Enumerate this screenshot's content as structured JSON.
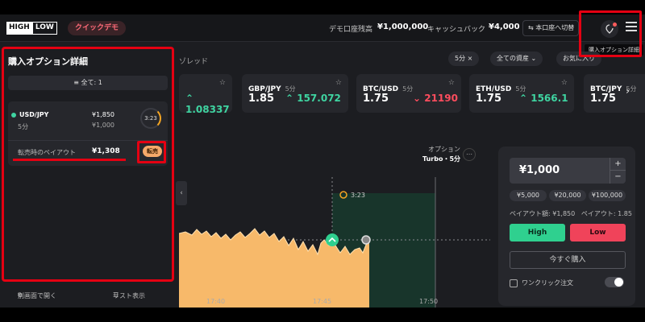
{
  "header": {
    "logo_high": "HIGH",
    "logo_low": "LOW",
    "demo_badge": "クイックデモ",
    "balance_label": "デモ口座残高",
    "balance_value": "¥1,000,000",
    "cashback_label": "キャッシュバック",
    "cashback_value": "¥4,000",
    "switch_account": "⇆ 本口座へ切替",
    "tooltip": "購入オプション詳細"
  },
  "filters": {
    "spread_label": "ゾレッド",
    "time_chip": "5分 ×",
    "asset_chip": "全ての資産 ⌄",
    "fav_chip": "お気に入り"
  },
  "assets": [
    {
      "name": "",
      "time": "",
      "payout": "",
      "price": "1.08337",
      "trend": "up"
    },
    {
      "name": "GBP/JPY",
      "time": "5分",
      "payout": "1.85",
      "price": "157.072",
      "trend": "up"
    },
    {
      "name": "BTC/USD",
      "time": "5分",
      "payout": "1.75",
      "price": "21190",
      "trend": "down"
    },
    {
      "name": "ETH/USD",
      "time": "5分",
      "payout": "1.75",
      "price": "1566.1",
      "trend": "up"
    },
    {
      "name": "BTC/JPY",
      "time": "5分",
      "payout": "1.75",
      "price": "",
      "trend": "up"
    }
  ],
  "left_panel": {
    "title": "購入オプション詳細",
    "filter": "全て: 1",
    "position": {
      "asset": "USD/JPY",
      "time": "5分",
      "payout_amount": "¥1,850",
      "invest_amount": "¥1,000",
      "timer": "3:23",
      "sell_payout_label": "転売時のペイアウト",
      "sell_payout_value": "¥1,308",
      "sell_button": "転売"
    },
    "footer_open": "別画面で開く",
    "footer_list": "リスト表示"
  },
  "chart": {
    "option_label": "オプション",
    "option_type": "Turbo・5分",
    "timer": "3:23",
    "x_ticks": [
      "17:40",
      "17:45",
      "17:50"
    ]
  },
  "trade": {
    "amount": "¥1,000",
    "presets": [
      "¥5,000",
      "¥20,000",
      "¥100,000"
    ],
    "payout_amount_line": "ペイアウト額: ¥1,850",
    "payout_rate_line": "ペイアウト: 1.85",
    "high": "High",
    "low": "Low",
    "buy_now": "今すぐ購入",
    "one_click": "ワンクリック注文"
  },
  "colors": {
    "up": "#3fd4a1",
    "down": "#ff4d5e",
    "highlight": "#e50012",
    "high_button": "#2fd08f",
    "low_button": "#f0435a",
    "chart_fill": "#f7b96a"
  }
}
